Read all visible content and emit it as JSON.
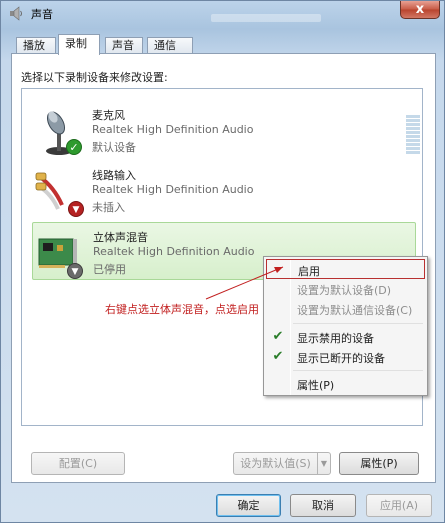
{
  "window": {
    "title": "声音",
    "close_label": "x"
  },
  "tabs": [
    {
      "label": "播放"
    },
    {
      "label": "录制"
    },
    {
      "label": "声音"
    },
    {
      "label": "通信"
    }
  ],
  "active_tab": "录制",
  "instruction": "选择以下录制设备来修改设置:",
  "devices": [
    {
      "name": "麦克风",
      "driver": "Realtek High Definition Audio",
      "status": "默认设备",
      "icon": "microphone-icon",
      "badge": "check"
    },
    {
      "name": "线路输入",
      "driver": "Realtek High Definition Audio",
      "status": "未插入",
      "icon": "line-in-cable-icon",
      "badge": "down"
    },
    {
      "name": "立体声混音",
      "driver": "Realtek High Definition Audio",
      "status": "已停用",
      "icon": "sound-card-icon",
      "badge": "down"
    }
  ],
  "context_menu": {
    "items": [
      {
        "label": "启用",
        "enabled": true,
        "checked": false
      },
      {
        "label": "设置为默认设备(D)",
        "enabled": false,
        "checked": false
      },
      {
        "label": "设置为默认通信设备(C)",
        "enabled": false,
        "checked": false
      },
      {
        "label": "显示禁用的设备",
        "enabled": true,
        "checked": true
      },
      {
        "label": "显示已断开的设备",
        "enabled": true,
        "checked": true
      },
      {
        "label": "属性(P)",
        "enabled": true,
        "checked": false
      }
    ]
  },
  "annotation": "右键点选立体声混音，点选启用",
  "buttons": {
    "configure": "配置(C)",
    "set_default": "设为默认值(S)",
    "properties": "属性(P)",
    "ok": "确定",
    "cancel": "取消",
    "apply": "应用(A)"
  },
  "colors": {
    "annotation": "#c22020",
    "selected_bg": "#d7efcc",
    "badge_ok": "#2e9a2e",
    "badge_down": "#b52222"
  }
}
